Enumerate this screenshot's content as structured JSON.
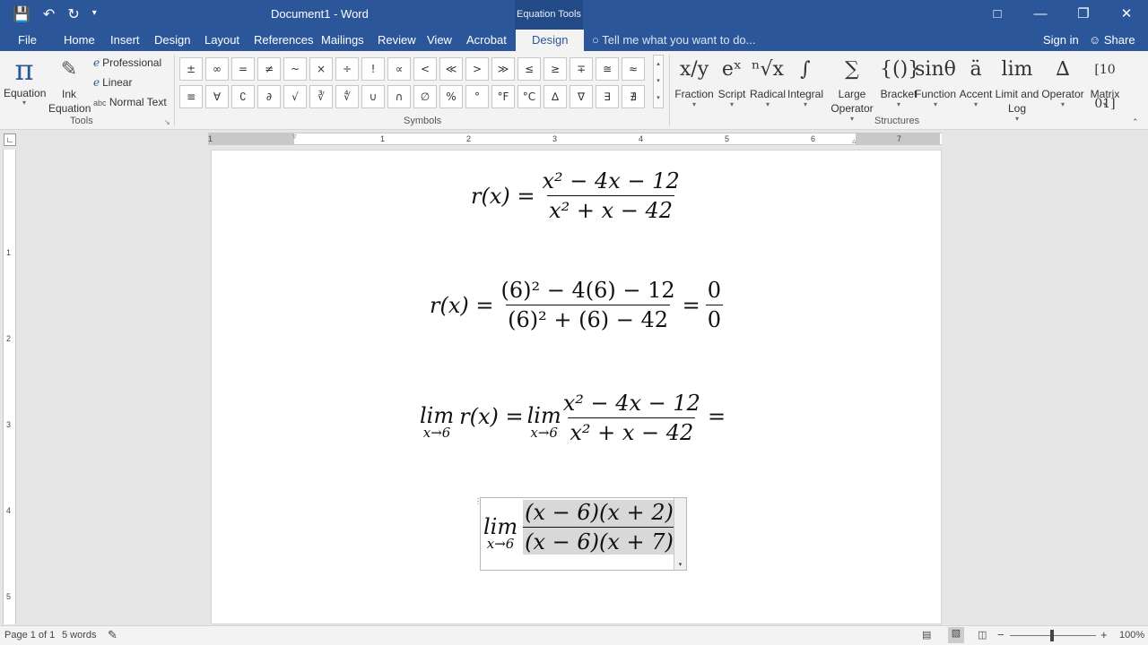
{
  "window": {
    "title": "Document1 - Word",
    "context_group": "Equation Tools",
    "controls": [
      "ribbon-display",
      "minimize",
      "restore",
      "close"
    ]
  },
  "qat": {
    "save_icon": "save-icon",
    "undo_icon": "undo-icon",
    "redo_icon": "redo-icon",
    "customize_icon": "customize-icon"
  },
  "tabs": [
    "File",
    "Home",
    "Insert",
    "Design",
    "Layout",
    "References",
    "Mailings",
    "Review",
    "View",
    "Acrobat",
    "Design"
  ],
  "active_tab_index": 10,
  "tell_me": "Tell me what you want to do...",
  "account": {
    "sign_in": "Sign in",
    "share": "Share"
  },
  "ribbon": {
    "tools": {
      "equation": "Equation",
      "ink": "Ink Equation",
      "professional": "Professional",
      "linear": "Linear",
      "normal_text": "Normal Text",
      "normal_text_prefix": "abc",
      "label": "Tools"
    },
    "symbols": {
      "label": "Symbols",
      "items": [
        "±",
        "∞",
        "=",
        "≠",
        "~",
        "×",
        "÷",
        "!",
        "∝",
        "<",
        "≪",
        ">",
        "≫",
        "≤",
        "≥",
        "∓",
        "≅",
        "≈",
        "≡",
        "∀",
        "∁",
        "∂",
        "√",
        "∛",
        "∜",
        "∪",
        "∩",
        "∅",
        "%",
        "°",
        "°F",
        "°C",
        "∆",
        "∇",
        "∃",
        "∄"
      ]
    },
    "structures": {
      "label": "Structures",
      "items": [
        {
          "label": "Fraction",
          "glyph": "x/y"
        },
        {
          "label": "Script",
          "glyph": "eˣ"
        },
        {
          "label": "Radical",
          "glyph": "ⁿ√x"
        },
        {
          "label": "Integral",
          "glyph": "∫"
        },
        {
          "label": "Large Operator",
          "glyph": "∑"
        },
        {
          "label": "Bracket",
          "glyph": "{()}"
        },
        {
          "label": "Function",
          "glyph": "sinθ"
        },
        {
          "label": "Accent",
          "glyph": "ä"
        },
        {
          "label": "Limit and Log",
          "glyph": "lim"
        },
        {
          "label": "Operator",
          "glyph": "∆"
        },
        {
          "label": "Matrix",
          "glyph": "[10 01]"
        }
      ]
    }
  },
  "ruler": {
    "h_numbers": [
      "1",
      "1",
      "2",
      "3",
      "4",
      "5",
      "6",
      "7"
    ],
    "v_numbers": [
      "1",
      "2",
      "3",
      "4",
      "5"
    ]
  },
  "document": {
    "eq1": {
      "lhs": "r(x) =",
      "num": "x² − 4x − 12",
      "den": "x² + x − 42"
    },
    "eq2": {
      "lhs": "r(x) =",
      "num": "(6)² − 4(6) − 12",
      "den": "(6)² + (6) − 42",
      "eq": "=",
      "rnum": "0",
      "rden": "0"
    },
    "eq3": {
      "lim": "lim",
      "sub": "x→6",
      "rx": "r(x) =",
      "num": "x² − 4x − 12",
      "den": "x² + x − 42",
      "tail": "="
    },
    "eq4": {
      "lim": "lim",
      "sub": "x→6",
      "num": "(x − 6)(x + 2)",
      "den": "(x − 6)(x + 7)"
    }
  },
  "status": {
    "page": "Page 1 of 1",
    "words": "5 words",
    "zoom": "100%",
    "zoom_minus": "−",
    "zoom_plus": "+"
  }
}
